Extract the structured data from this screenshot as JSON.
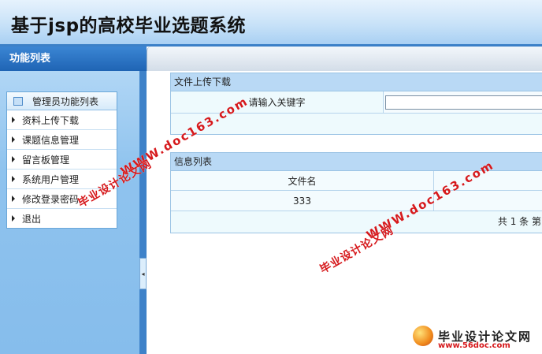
{
  "header": {
    "title": "基于jsp的高校毕业选题系统"
  },
  "sidebar": {
    "title": "功能列表",
    "menu_title": "管理员功能列表",
    "items": [
      {
        "label": "资料上传下载"
      },
      {
        "label": "课题信息管理"
      },
      {
        "label": "留言板管理"
      },
      {
        "label": "系统用户管理"
      },
      {
        "label": "修改登录密码"
      },
      {
        "label": "退出"
      }
    ],
    "collapse_glyph": "◂"
  },
  "upload_panel": {
    "title": "文件上传下载",
    "keyword_label": "请输入关键字",
    "keyword_value": ""
  },
  "list_panel": {
    "title": "信息列表",
    "columns": [
      "文件名"
    ],
    "rows": [
      {
        "filename": "333"
      }
    ],
    "pager_text": "共 1 条 第"
  },
  "watermarks": {
    "url": "WWW.doc163.com",
    "cn": "毕业设计论文网",
    "logo_text": "毕业设计论文网",
    "logo_url": "www.56doc.com"
  }
}
